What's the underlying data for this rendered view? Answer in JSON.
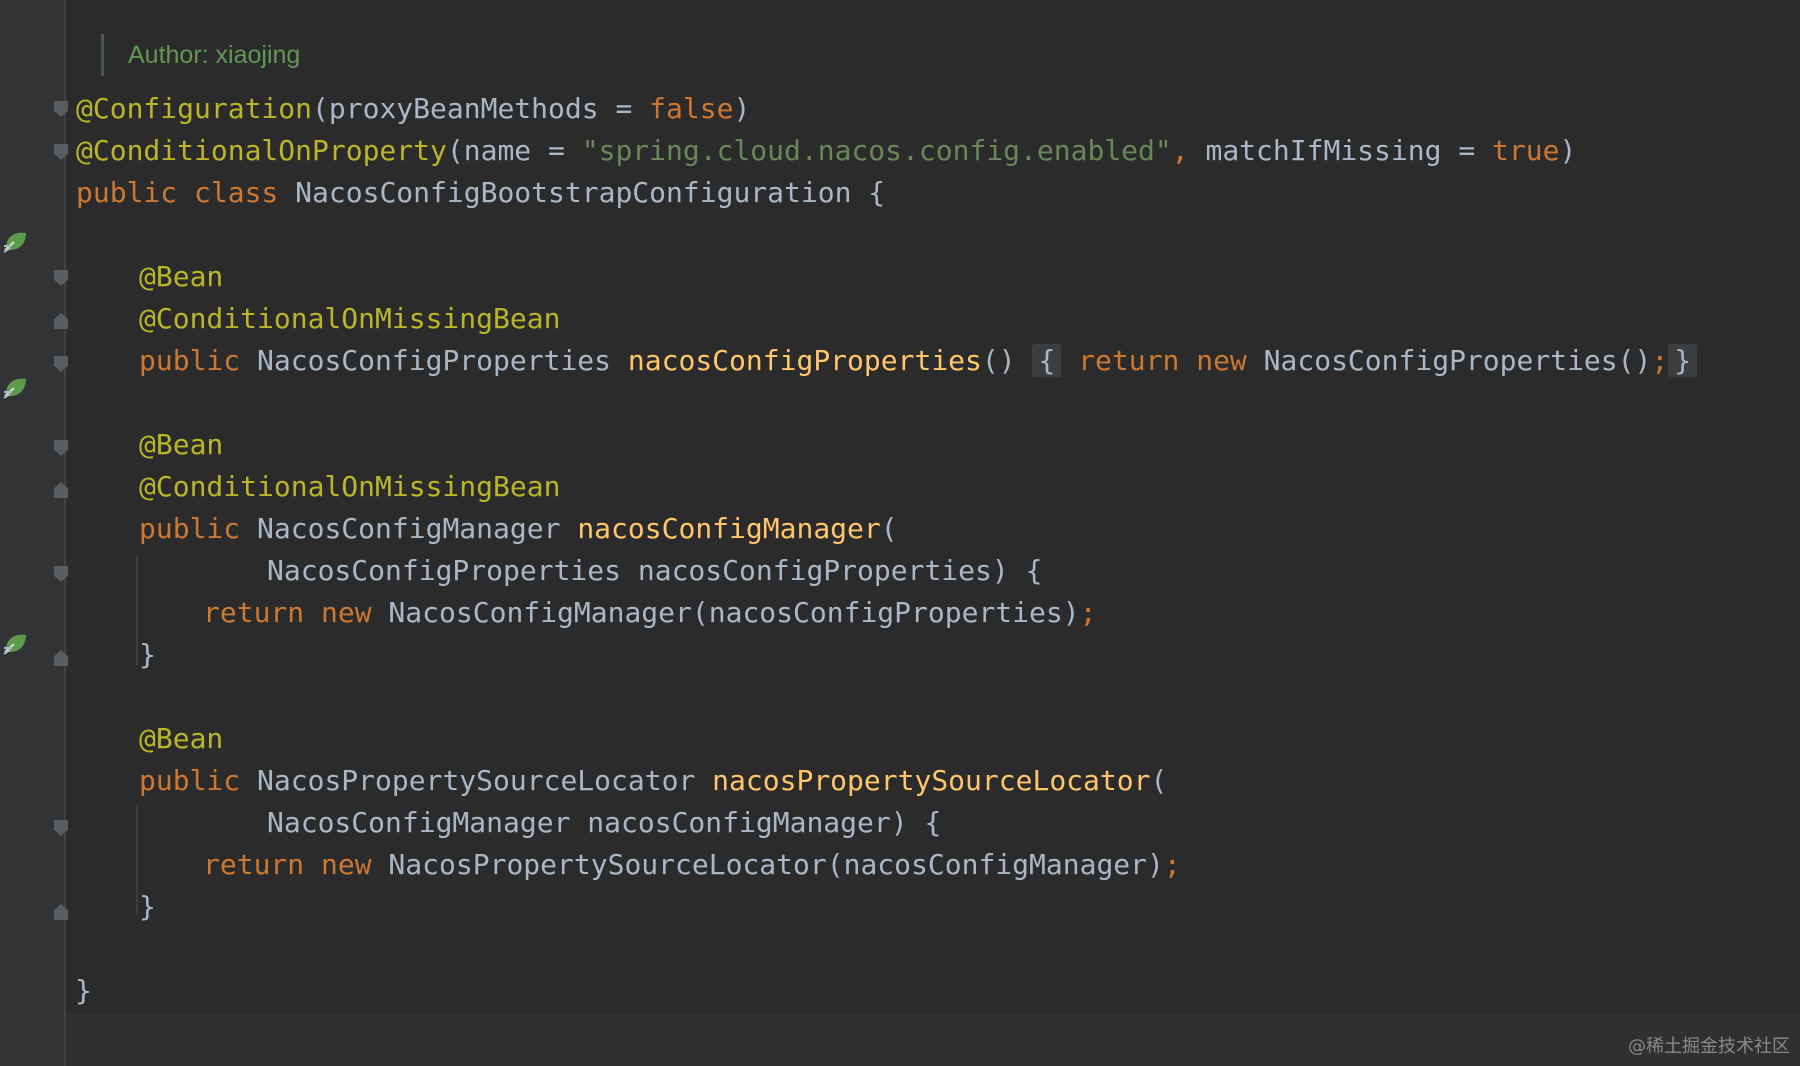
{
  "author_line": "Author: xiaojing",
  "code": {
    "l1": {
      "ann": "@Configuration",
      "p1": "(proxyBeanMethods = ",
      "kw": "false",
      "p2": ")"
    },
    "l2": {
      "ann": "@ConditionalOnProperty",
      "p1": "(name = ",
      "str": "\"spring.cloud.nacos.config.enabled\"",
      "c": ",",
      "p2": " matchIfMissing = ",
      "kw": "true",
      "p3": ")"
    },
    "l3": {
      "kw": "public class",
      "p1": " NacosConfigBootstrapConfiguration {"
    },
    "l4": {
      "ann": "@Bean"
    },
    "l5": {
      "ann": "@ConditionalOnMissingBean"
    },
    "l6": {
      "kw1": "public",
      "p1": " NacosConfigProperties ",
      "fn": "nacosConfigProperties",
      "p2": "() ",
      "b1": "{",
      "kw2": "return new",
      "p3": " NacosConfigProperties()",
      "semi": ";",
      "b2": "}"
    },
    "l7": {
      "ann": "@Bean"
    },
    "l8": {
      "ann": "@ConditionalOnMissingBean"
    },
    "l9": {
      "kw": "public",
      "p1": " NacosConfigManager ",
      "fn": "nacosConfigManager",
      "p2": "("
    },
    "l10": {
      "p1": "NacosConfigProperties nacosConfigProperties) {"
    },
    "l11": {
      "kw": "return new",
      "p1": " NacosConfigManager(nacosConfigProperties)",
      "semi": ";"
    },
    "l12": {
      "p1": "}"
    },
    "l13": {
      "ann": "@Bean"
    },
    "l14": {
      "kw": "public",
      "p1": " NacosPropertySourceLocator ",
      "fn": "nacosPropertySourceLocator",
      "p2": "("
    },
    "l15": {
      "p1": "NacosConfigManager nacosConfigManager) {"
    },
    "l16": {
      "kw": "return new",
      "p1": " NacosPropertySourceLocator(nacosConfigManager)",
      "semi": ";"
    },
    "l17": {
      "p1": "}"
    },
    "l18": {
      "p1": "}"
    }
  },
  "gutter_icons": [
    "spring-bean-icon",
    "spring-bean-icon",
    "spring-bean-icon"
  ],
  "watermark": "@稀土掘金技术社区",
  "colors": {
    "keyword": "#cc7832",
    "annotation": "#bbb529",
    "string": "#6a8759",
    "method": "#ffc66d",
    "text": "#a9b7c6",
    "background": "#2b2b2b"
  }
}
